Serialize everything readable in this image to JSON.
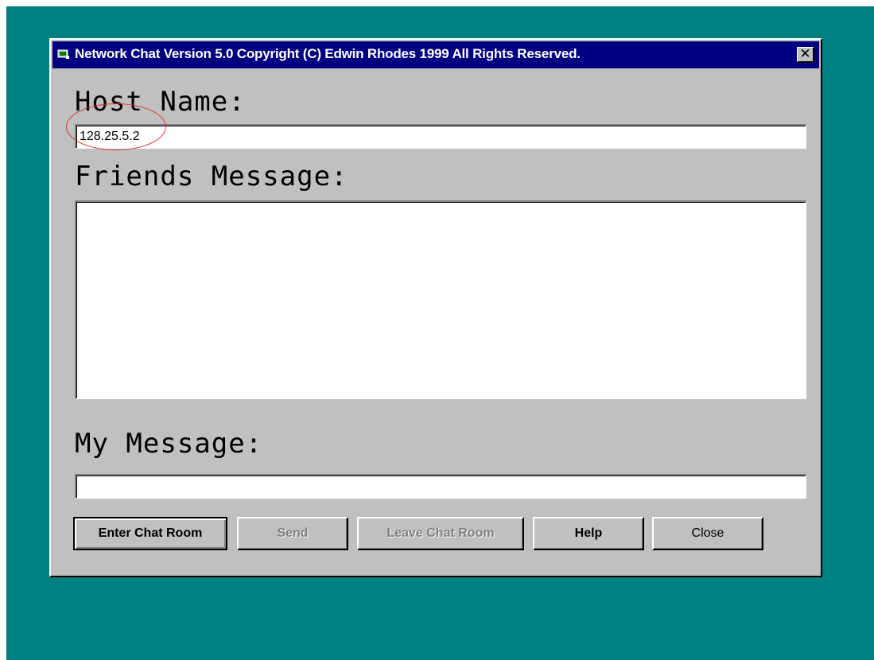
{
  "window": {
    "title": "Network Chat Version 5.0 Copyright (C) Edwin Rhodes 1999 All Rights Reserved.",
    "close_glyph": "✕"
  },
  "labels": {
    "host_name": "Host Name:",
    "friends_message": "Friends Message:",
    "my_message": "My Message:"
  },
  "fields": {
    "host_name_value": "128.25.5.2",
    "friends_message_value": "",
    "my_message_value": ""
  },
  "buttons": {
    "enter": "Enter Chat Room",
    "send": "Send",
    "leave": "Leave Chat Room",
    "help": "Help",
    "close": "Close"
  },
  "colors": {
    "desktop": "#008080",
    "titlebar": "#000080",
    "face": "#c0c0c0",
    "annotation_circle": "#e03030"
  }
}
